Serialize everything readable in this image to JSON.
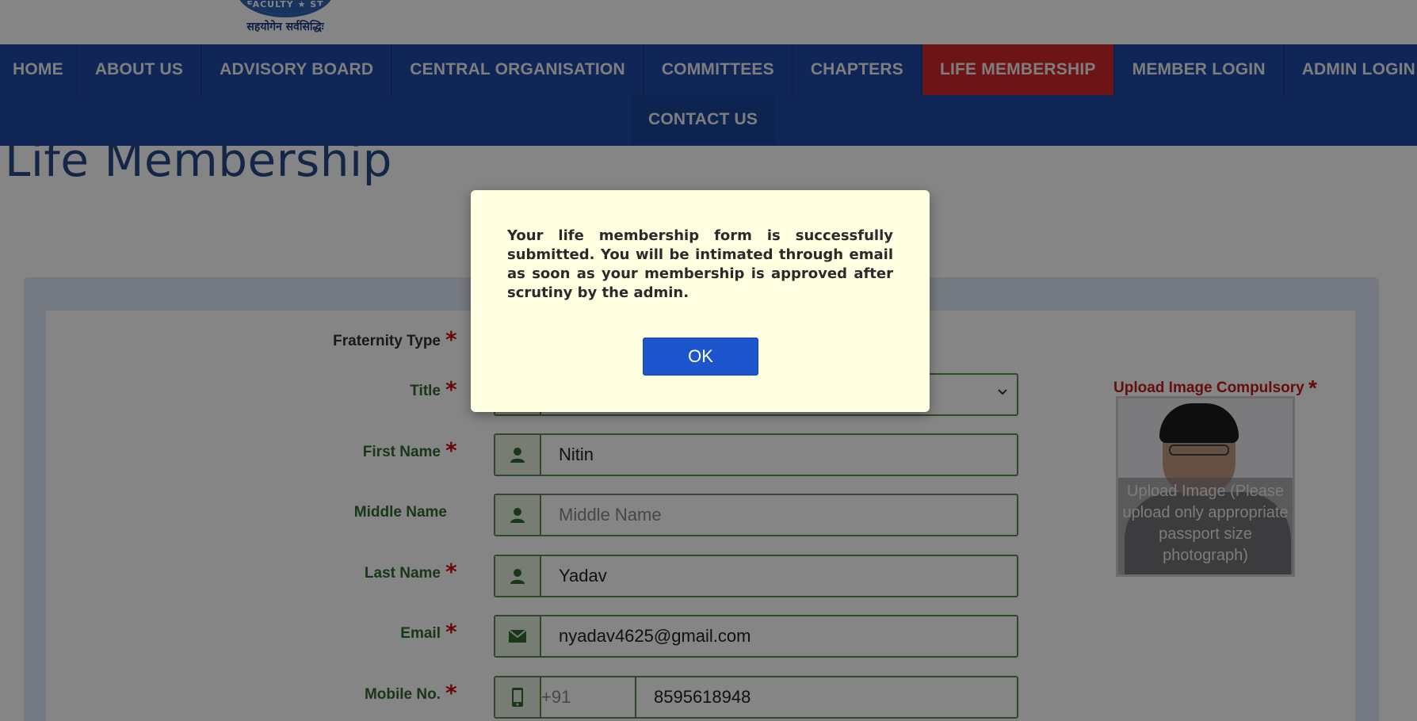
{
  "header": {
    "logo_band_text": "FACULTY ★ ST",
    "logo_tagline": "सहयोगेन सर्वसिद्धिः"
  },
  "nav": {
    "row1": [
      {
        "label": "HOME",
        "active": false
      },
      {
        "label": "ABOUT US",
        "active": false
      },
      {
        "label": "ADVISORY BOARD",
        "active": false
      },
      {
        "label": "CENTRAL ORGANISATION",
        "active": false
      },
      {
        "label": "COMMITTEES",
        "active": false
      },
      {
        "label": "CHAPTERS",
        "active": false
      },
      {
        "label": "LIFE MEMBERSHIP",
        "active": true
      },
      {
        "label": "MEMBER LOGIN",
        "active": false
      },
      {
        "label": "ADMIN LOGIN",
        "active": false
      }
    ],
    "row2": [
      {
        "label": "CONTACT US",
        "active": false
      }
    ],
    "colors": {
      "bar": "#1d4aa6",
      "active": "#d2272d"
    }
  },
  "page": {
    "title": "Life Membership"
  },
  "form": {
    "fraternity_label": "Fraternity Type",
    "title_label": "Title",
    "first_name_label": "First Name",
    "first_name_value": "Nitin",
    "middle_name_label": "Middle Name",
    "middle_name_placeholder": "Middle Name",
    "last_name_label": "Last Name",
    "last_name_value": "Yadav",
    "email_label": "Email",
    "email_value": "nyadav4625@gmail.com",
    "mobile_label": "Mobile No.",
    "mobile_code": "+91",
    "mobile_value": "8595618948",
    "required_mark": "*",
    "upload_label": "Upload Image Compulsory",
    "upload_hint": "Upload Image (Please upload only appropriate passport size photograph)"
  },
  "modal": {
    "message": "Your life membership form is successfully submitted. You will be intimated through email as soon as your membership is approved after scrutiny by the admin.",
    "ok_label": "OK",
    "background": "#fefee0",
    "button_color": "#1c55cc"
  },
  "icons": {
    "name_field": "user-icon",
    "email_field": "envelope-icon",
    "mobile_field": "mobile-phone-icon",
    "select": "chevron-down-icon"
  }
}
